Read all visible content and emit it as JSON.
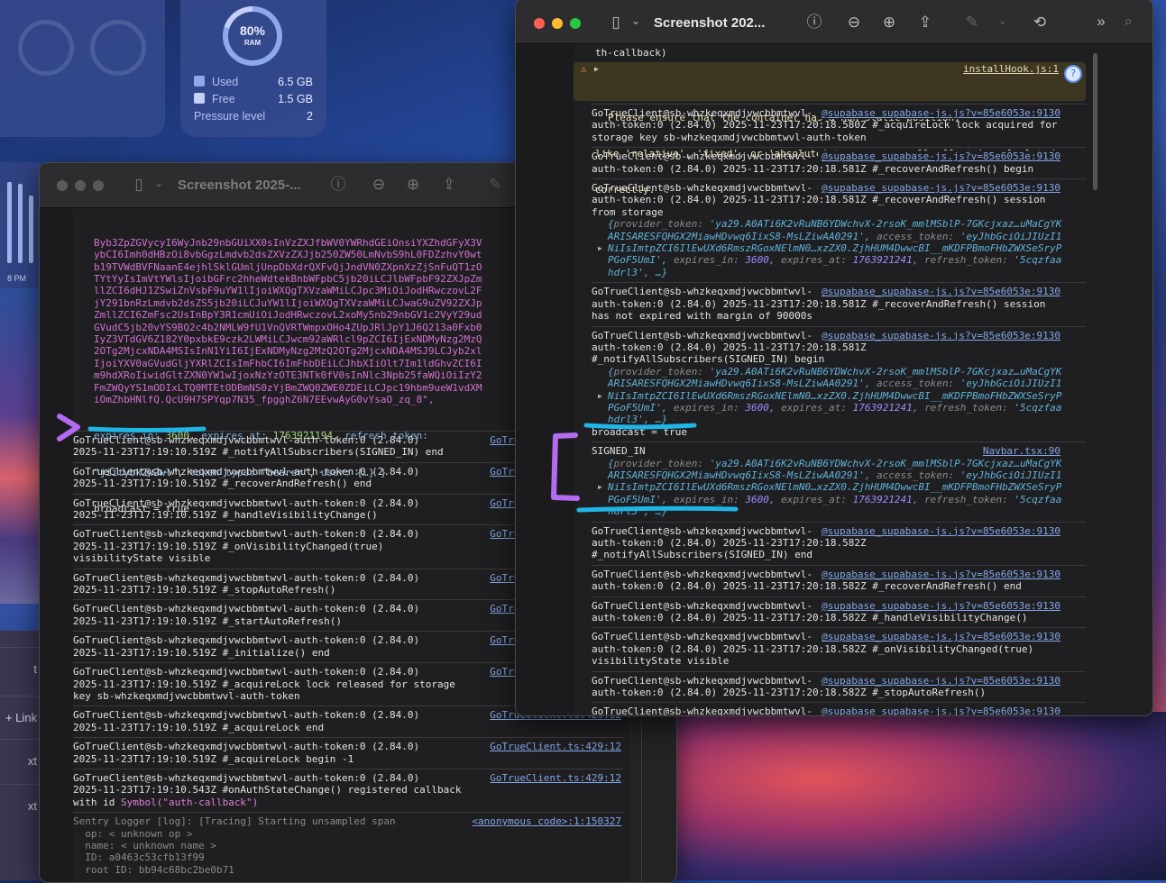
{
  "desktop": {
    "ram_widget": {
      "percent": "80%",
      "label": "RAM",
      "used_label": "Used",
      "used_value": "6.5 GB",
      "free_label": "Free",
      "free_value": "1.5 GB",
      "pressure_label": "Pressure level",
      "pressure_value": "2",
      "used_fraction": 0.8,
      "used_color": "#8ea8ee",
      "free_color": "#c3d1f6"
    },
    "chart_time_label": "8 PM",
    "side_items": [
      "t",
      "+ Link",
      "xt",
      "xt"
    ]
  },
  "left_window": {
    "title": "Screenshot 2025-...",
    "blob_lines": [
      "Byb3ZpZGVycyI6WyJnb29nbGUiXX0sInVzZXJfbWV0YWRhdGEiOnsiYXZhdGFyX3V",
      "ybCI6Imh0dHBzOi8vbGgzLmdvb2dsZXVzZXJjb250ZW50LmNvbS9hL0FDZzhvY0wt",
      "b19TVWdBVFNaanE4ejhlSklGUmljUnpDbXdrQXFvQjJndVN0ZXpnXzZjSnFuQT1zO",
      "TYtYyIsImVtYWlsIjoibGFrc2hheWdtekBnbWFpbC5jb20iLCJlbWFpbF92ZXJpZm",
      "llZCI6dHJ1ZSwiZnVsbF9uYW1lIjoiWXQgTXVzaWMiLCJpc3MiOiJodHRwczovL2F",
      "jY291bnRzLmdvb2dsZS5jb20iLCJuYW1lIjoiWXQgTXVzaWMiLCJwaG9uZV92ZXJp",
      "ZmllZCI6ZmFsc2UsInBpY3R1cmUiOiJodHRwczovL2xoMy5nb29nbGV1c2VyY29ud",
      "GVudC5jb20vYS9BQ2c4b2NMLW9fU1VnQVRTWmpxOHo4ZUpJRlJpY1J6Q213a0Fxb0",
      "IyZ3VTdGV6Z182Y0pxbkE9czk2LWMiLCJwcm92aWRlcl9pZCI6IjExNDMyNzg2MzQ",
      "2OTg2MjcxNDA4MSIsInN1YiI6IjExNDMyNzg2MzQ2OTg2MjcxNDA4MSJ9LCJyb2xl",
      "IjoiYXV0aGVudGljYXRlZCIsImFhbCI6ImFhbDEiLCJhbXIiOlt7Im1ldGhvZCI6I",
      "m9hdXRoIiwidGltZXN0YW1wIjoxNzYzOTE3NTk0fV0sInNlc3Npb25faWQiOiIzY2",
      "FmZWQyYS1mODIxLTQ0MTEtODBmNS0zYjBmZWQ0ZWE0ZDEiLCJpc19hbm9ueW1vdXM",
      "iOmZhbHNlfQ.QcU9H7SPYqp7N35_fpgghZ6N7EEvwAyG0vYsaO_zq_8\","
    ],
    "session_tail": {
      "k1": "expires_in: ",
      "v1": "3600",
      "p1": ", ",
      "k2": "expires_at: ",
      "v2": "1763921194",
      "p2": ", ",
      "k3": "refresh_token:",
      "s3": "\"jiitybk2w2wl\"",
      "p3": ", ",
      "k4": "token_type: ",
      "s4": "\"bearer\"",
      "p4": ", ",
      "k5": "user: ",
      "s5": "{…} }"
    },
    "broadcast": "broadcast = true",
    "rows": [
      {
        "lines": [
          "GoTrueClient@sb-whzkeqxmdjvwcbbmtwvl-auth-token:0 (2.84.0)",
          "2025-11-23T17:19:10.519Z #_notifyAllSubscribers(SIGNED_IN) end"
        ],
        "link": "GoTrueClient.ts:429:12"
      },
      {
        "lines": [
          "GoTrueClient@sb-whzkeqxmdjvwcbbmtwvl-auth-token:0 (2.84.0)",
          "2025-11-23T17:19:10.519Z #_recoverAndRefresh() end"
        ],
        "link": "GoTrueClient.ts:429:12"
      },
      {
        "lines": [
          "GoTrueClient@sb-whzkeqxmdjvwcbbmtwvl-auth-token:0 (2.84.0)",
          "2025-11-23T17:19:10.519Z #_handleVisibilityChange()"
        ],
        "link": "GoTrueClient.ts:429:12"
      },
      {
        "lines": [
          "GoTrueClient@sb-whzkeqxmdjvwcbbmtwvl-auth-token:0 (2.84.0)",
          "2025-11-23T17:19:10.519Z #_onVisibilityChanged(true)",
          "visibilityState visible"
        ],
        "link": "GoTrueClient.ts:429:12"
      },
      {
        "lines": [
          "GoTrueClient@sb-whzkeqxmdjvwcbbmtwvl-auth-token:0 (2.84.0)",
          "2025-11-23T17:19:10.519Z #_stopAutoRefresh()"
        ],
        "link": "GoTrueClient.ts:429:12"
      },
      {
        "lines": [
          "GoTrueClient@sb-whzkeqxmdjvwcbbmtwvl-auth-token:0 (2.84.0)",
          "2025-11-23T17:19:10.519Z #_startAutoRefresh()"
        ],
        "link": "GoTrueClient.ts:429:12"
      },
      {
        "lines": [
          "GoTrueClient@sb-whzkeqxmdjvwcbbmtwvl-auth-token:0 (2.84.0)",
          "2025-11-23T17:19:10.519Z #_initialize() end"
        ],
        "link": "GoTrueClient.ts:429:12"
      },
      {
        "lines": [
          "GoTrueClient@sb-whzkeqxmdjvwcbbmtwvl-auth-token:0 (2.84.0)",
          "2025-11-23T17:19:10.519Z #_acquireLock lock released for storage",
          "key sb-whzkeqxmdjvwcbbmtwvl-auth-token"
        ],
        "link": "GoTrueClient.ts:429:12"
      },
      {
        "lines": [
          "GoTrueClient@sb-whzkeqxmdjvwcbbmtwvl-auth-token:0 (2.84.0)",
          "2025-11-23T17:19:10.519Z #_acquireLock end"
        ],
        "link": "GoTrueClient.ts:429:12"
      },
      {
        "lines": [
          "GoTrueClient@sb-whzkeqxmdjvwcbbmtwvl-auth-token:0 (2.84.0)",
          "2025-11-23T17:19:10.519Z #_acquireLock begin -1"
        ],
        "link": "GoTrueClient.ts:429:12"
      },
      {
        "lines": [
          "GoTrueClient@sb-whzkeqxmdjvwcbbmtwvl-auth-token:0 (2.84.0)",
          "2025-11-23T17:19:10.543Z #onAuthStateChange() registered callback"
        ],
        "tail_prefix": "with id ",
        "tail_symbol": "Symbol(\"auth-callback\")",
        "link": "GoTrueClient.ts:429:12"
      },
      {
        "gray": true,
        "lines": [
          "Sentry Logger [log]: [Tracing] Starting unsampled span",
          "  op: < unknown op >",
          "  name: < unknown name >",
          "  ID: a0463c53cfb13f99",
          "  root ID: bb94c68bc2be0b71"
        ],
        "link": "<anonymous code>:1:150327"
      }
    ]
  },
  "right_window": {
    "title": "Screenshot 202...",
    "top_fragment": "th-callback)",
    "warning": {
      "lines": [
        "Please ensure that the container has a non-static position,",
        "like 'relative', 'fixed', or 'absolute' to ensure scroll offset is calculated",
        "correctly."
      ],
      "link": "installHook.js:1"
    },
    "rows": [
      {
        "lines": [
          "GoTrueClient@sb-whzkeqxmdjvwcbbmtwvl-",
          "auth-token:0 (2.84.0) 2025-11-23T17:20:18.580Z #_acquireLock lock acquired for",
          "storage key sb-whzkeqxmdjvwcbbmtwvl-auth-token"
        ],
        "link": "@supabase_supabase-js.js?v=85e6053e:9130"
      },
      {
        "lines": [
          "GoTrueClient@sb-whzkeqxmdjvwcbbmtwvl-",
          "auth-token:0 (2.84.0) 2025-11-23T17:20:18.581Z #_recoverAndRefresh() begin"
        ],
        "link": "@supabase_supabase-js.js?v=85e6053e:9130"
      },
      {
        "lines": [
          "GoTrueClient@sb-whzkeqxmdjvwcbbmtwvl-",
          "auth-token:0 (2.84.0) 2025-11-23T17:20:18.581Z #_recoverAndRefresh() session",
          "from storage"
        ],
        "object": true,
        "link": "@supabase_supabase-js.js?v=85e6053e:9130"
      },
      {
        "lines": [
          "GoTrueClient@sb-whzkeqxmdjvwcbbmtwvl-",
          "auth-token:0 (2.84.0) 2025-11-23T17:20:18.581Z #_recoverAndRefresh() session",
          "has not expired with margin of 90000s"
        ],
        "link": "@supabase_supabase-js.js?v=85e6053e:9130"
      },
      {
        "lines": [
          "GoTrueClient@sb-whzkeqxmdjvwcbbmtwvl-",
          "auth-token:0 (2.84.0) 2025-11-23T17:20:18.581Z",
          "#_notifyAllSubscribers(SIGNED_IN) begin"
        ],
        "object": true,
        "after": "broadcast = true",
        "link": "@supabase_supabase-js.js?v=85e6053e:9130"
      },
      {
        "lines": [
          "SIGNED_IN"
        ],
        "object": true,
        "link": "Navbar.tsx:90"
      },
      {
        "lines": [
          "GoTrueClient@sb-whzkeqxmdjvwcbbmtwvl-",
          "auth-token:0 (2.84.0) 2025-11-23T17:20:18.582Z",
          "#_notifyAllSubscribers(SIGNED_IN) end"
        ],
        "link": "@supabase_supabase-js.js?v=85e6053e:9130"
      },
      {
        "lines": [
          "GoTrueClient@sb-whzkeqxmdjvwcbbmtwvl-",
          "auth-token:0 (2.84.0) 2025-11-23T17:20:18.582Z #_recoverAndRefresh() end"
        ],
        "link": "@supabase_supabase-js.js?v=85e6053e:9130"
      },
      {
        "lines": [
          "GoTrueClient@sb-whzkeqxmdjvwcbbmtwvl-",
          "auth-token:0 (2.84.0) 2025-11-23T17:20:18.582Z #_handleVisibilityChange()"
        ],
        "link": "@supabase_supabase-js.js?v=85e6053e:9130"
      },
      {
        "lines": [
          "GoTrueClient@sb-whzkeqxmdjvwcbbmtwvl-",
          "auth-token:0 (2.84.0) 2025-11-23T17:20:18.582Z #_onVisibilityChanged(true)",
          "visibilityState visible"
        ],
        "link": "@supabase_supabase-js.js?v=85e6053e:9130"
      },
      {
        "lines": [
          "GoTrueClient@sb-whzkeqxmdjvwcbbmtwvl-",
          "auth-token:0 (2.84.0) 2025-11-23T17:20:18.582Z #_stopAutoRefresh()"
        ],
        "link": "@supabase_supabase-js.js?v=85e6053e:9130"
      },
      {
        "lines": [
          "GoTrueClient@sb-whzkeqxmdjvwcbbmtwvl-",
          "auth-token:0 (2.84.0) 2025-11-23T17:20:18.582Z #_startAutoRefresh()"
        ],
        "link": "@supabase_supabase-js.js?v=85e6053e:9130"
      },
      {
        "lines": [
          "GoTrueClient@sb-whzkeqxmdjvwcbbmtwvl-"
        ],
        "link": "@supabase_supabase-js.js?v=85e6053e:9130"
      }
    ],
    "session_object_lines": [
      "{provider_token: 'ya29.A0ATi6K2vRuNB6YDWchvX-2rsoK_mmlMSblP-7GKcjxaz…uMaCgYK",
      "ARISARESFQHGX2MiawHDvwq6IixS8-MsLZiwAA0291', access_token: 'eyJhbGciOiJIUzI1",
      "NiIsImtpZCI6IlEwUXd6RmszRGoxNElmN0…xzZX0.ZjhHUM4DwwcBI__mKDFPBmoFHbZWXSeSryP",
      "PGoF5UmI', expires_in: 3600, expires_at: 1763921241, refresh_token: '5cqzfaa",
      "hdrl3', …}"
    ]
  },
  "icons": {
    "info": "ⓘ",
    "zoom_out": "⊖",
    "zoom_in": "⊕",
    "share": "⇪",
    "pencil": "✎",
    "rotate": "⟲",
    "more": "»",
    "search": "⌕",
    "sidebar": "▯",
    "chevron": "⌄",
    "warning": "⚠",
    "expand": "▶"
  },
  "colors": {
    "close": "#fe5f57",
    "minimize": "#febc2e",
    "zoom": "#28c840",
    "annotation_purple": "#b36cf0",
    "annotation_cyan": "#1fb6e6"
  }
}
